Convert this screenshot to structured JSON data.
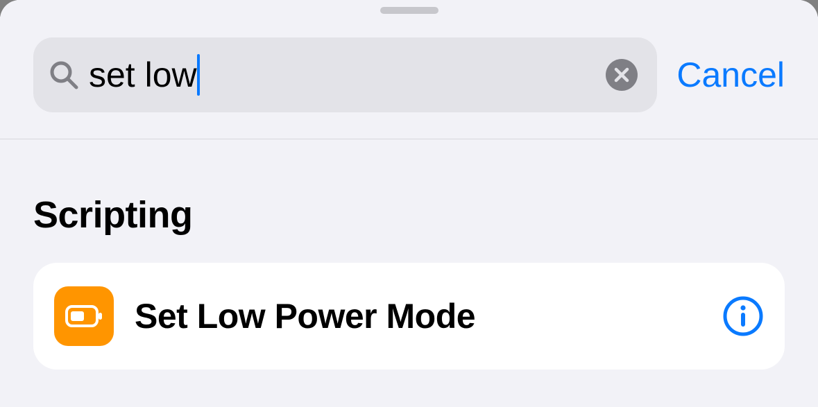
{
  "search": {
    "value": "set low",
    "cancel_label": "Cancel"
  },
  "sections": [
    {
      "title": "Scripting",
      "items": [
        {
          "title": "Set Low Power Mode",
          "icon_bg": "#ff9500"
        }
      ]
    }
  ],
  "colors": {
    "accent": "#0a7aff"
  }
}
